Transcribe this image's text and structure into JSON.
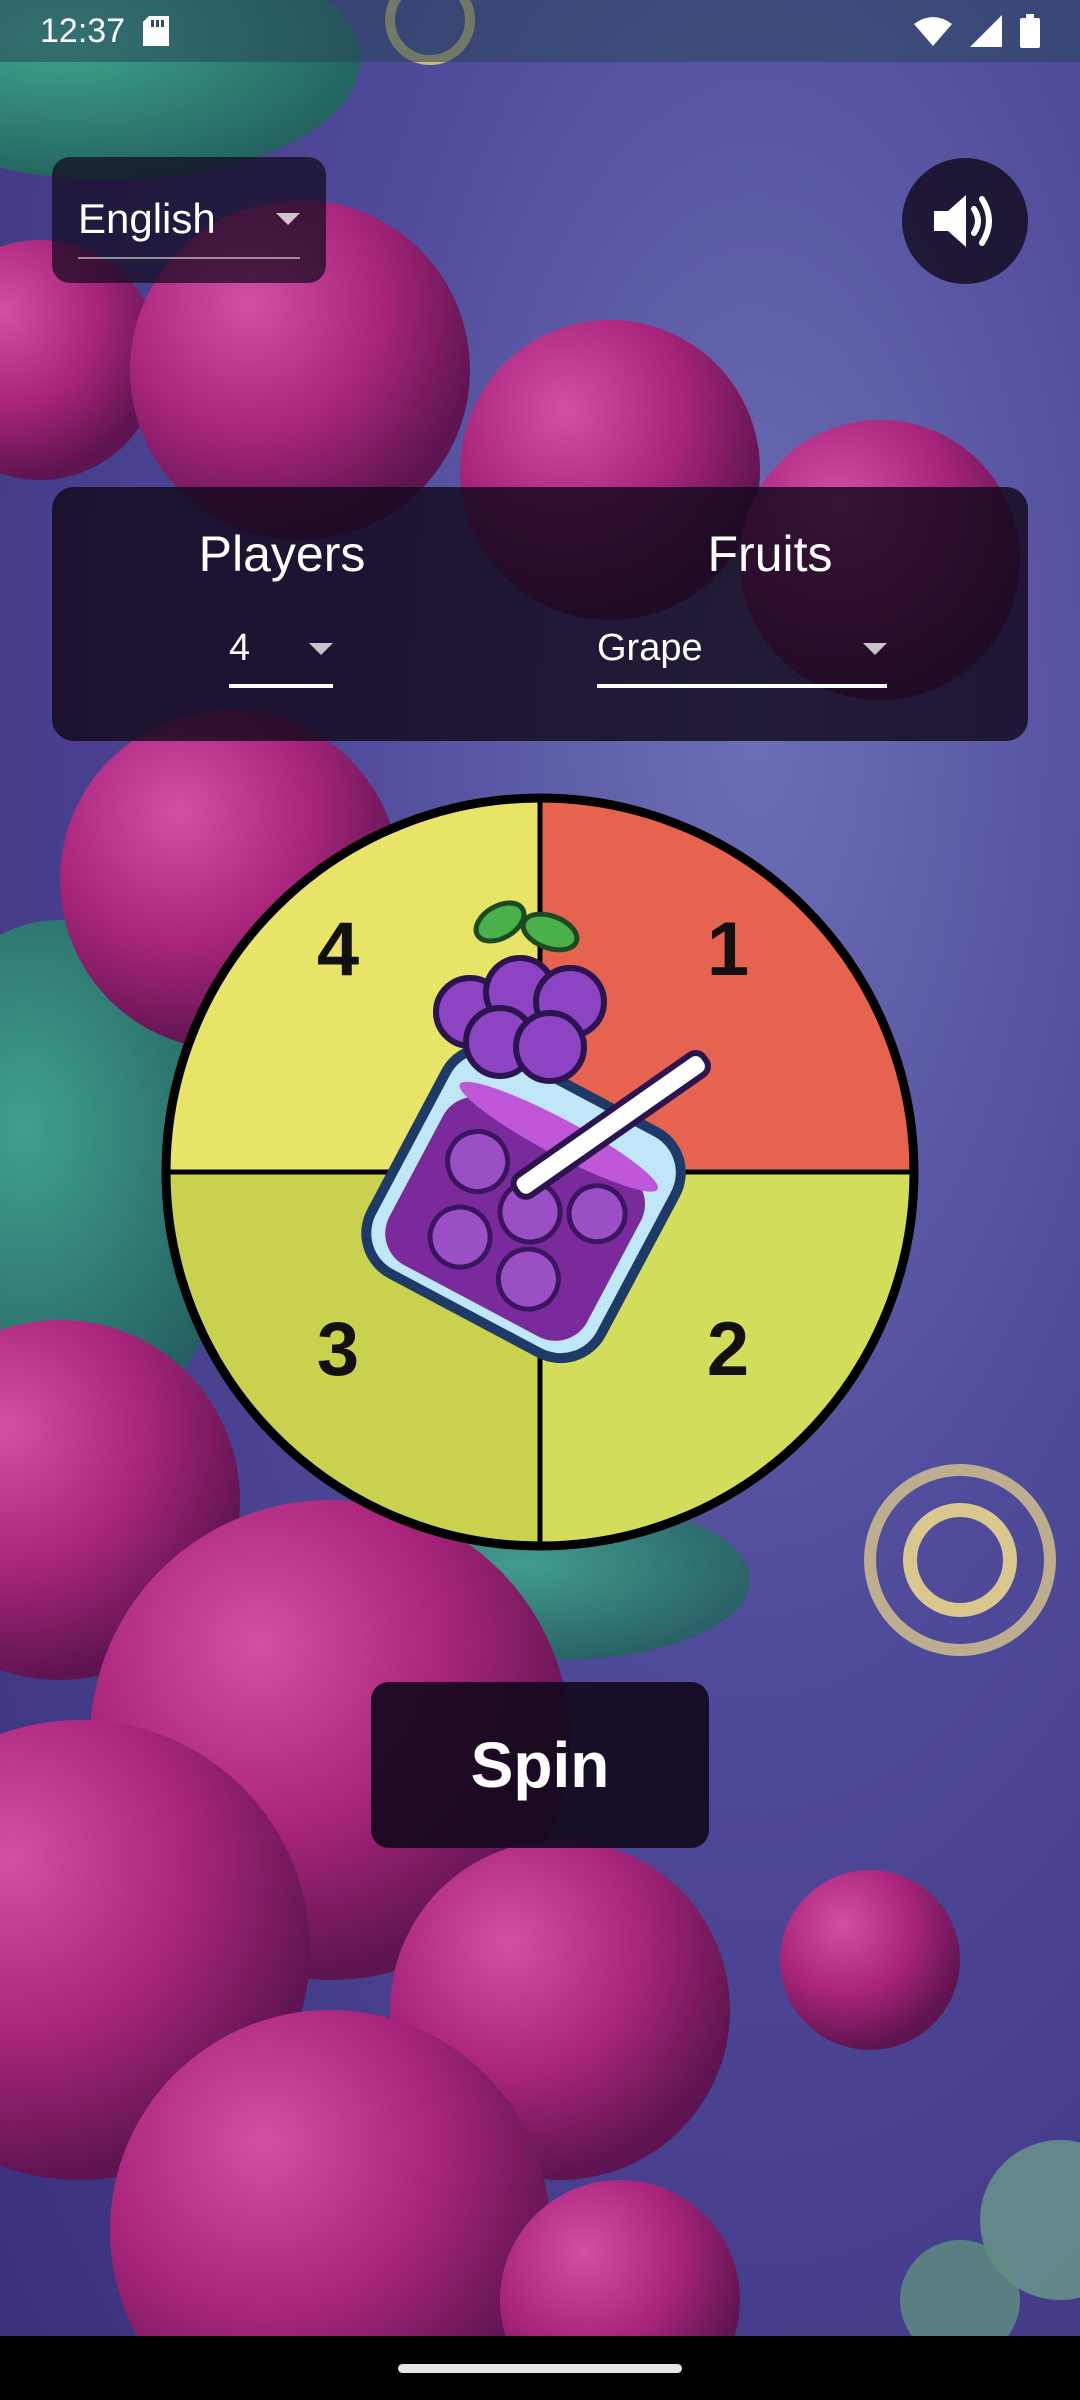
{
  "status_bar": {
    "time": "12:37"
  },
  "language": {
    "selected": "English"
  },
  "sound": {
    "icon": "volume-up-icon"
  },
  "settings_panel": {
    "players_label": "Players",
    "players_value": "4",
    "fruits_label": "Fruits",
    "fruits_value": "Grape"
  },
  "wheel": {
    "segments": [
      {
        "label": "1",
        "color": "#e5634f"
      },
      {
        "label": "2",
        "color": "#d2de5b"
      },
      {
        "label": "3",
        "color": "#c9d24f"
      },
      {
        "label": "4",
        "color": "#e8e468"
      }
    ],
    "center_icon": "grape-juice-cup-icon"
  },
  "spin": {
    "label": "Spin"
  }
}
